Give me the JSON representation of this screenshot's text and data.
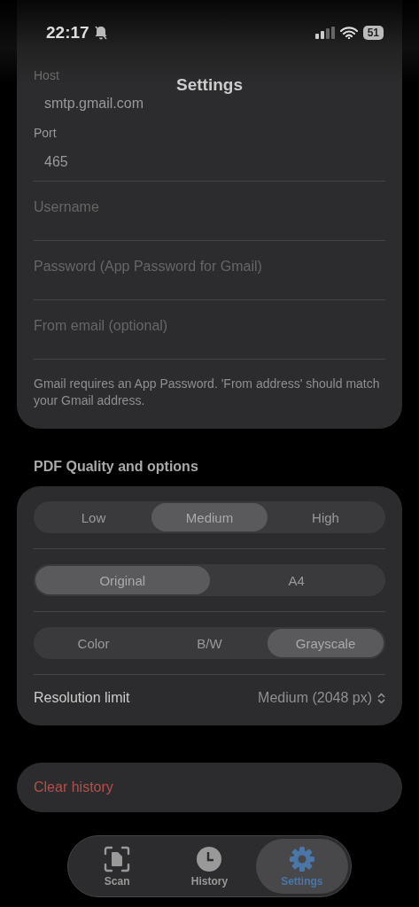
{
  "status_bar": {
    "time": "22:17",
    "battery": "51"
  },
  "title": "Settings",
  "email": {
    "host": {
      "label": "Host",
      "value": "smtp.gmail.com"
    },
    "port": {
      "label": "Port",
      "value": "465"
    },
    "fields": [
      {
        "placeholder": "Username"
      },
      {
        "placeholder": "Password (App Password for Gmail)"
      },
      {
        "placeholder": "From email (optional)"
      }
    ],
    "hint": "Gmail requires an App Password. 'From address' should match your Gmail address."
  },
  "pdf": {
    "heading": "PDF Quality and options",
    "segments": [
      [
        {
          "label": "Low",
          "selected": false
        },
        {
          "label": "Medium",
          "selected": true
        },
        {
          "label": "High",
          "selected": false
        }
      ],
      [
        {
          "label": "Original",
          "selected": true
        },
        {
          "label": "A4",
          "selected": false
        }
      ],
      [
        {
          "label": "Color",
          "selected": false
        },
        {
          "label": "B/W",
          "selected": false
        },
        {
          "label": "Grayscale",
          "selected": true
        }
      ]
    ],
    "resolution": {
      "label": "Resolution limit",
      "value": "Medium (2048 px)"
    }
  },
  "clear_history": "Clear history",
  "tabs": [
    {
      "kind": "scan",
      "label": "Scan",
      "selected": false
    },
    {
      "kind": "history",
      "label": "History",
      "selected": false
    },
    {
      "kind": "settings",
      "label": "Settings",
      "selected": true
    }
  ]
}
